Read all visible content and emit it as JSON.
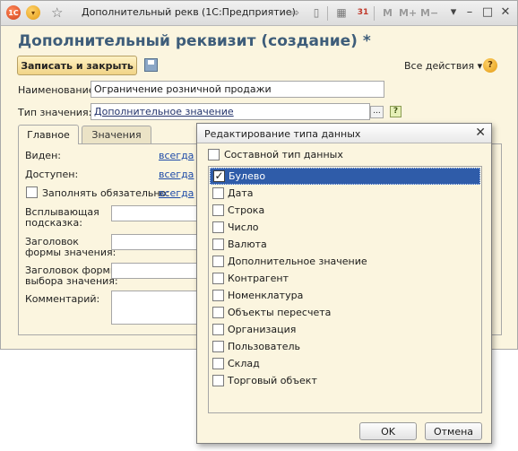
{
  "window": {
    "title": "Дополнительный рекв...",
    "app_name": "(1С:Предприятие)",
    "m_labels": [
      "M",
      "M+",
      "M−"
    ]
  },
  "form": {
    "title": "Дополнительный реквизит (создание) *",
    "save_close_label": "Записать и закрыть",
    "all_actions_label": "Все действия ▾",
    "name_label": "Наименование:",
    "name_value": "Ограничение розничной продажи",
    "value_type_label": "Тип значения:",
    "value_type_value": "Дополнительное значение",
    "value_type_button": "...",
    "tabs": [
      {
        "label": "Главное"
      },
      {
        "label": "Значения"
      }
    ],
    "main_tab": {
      "visible_label": "Виден:",
      "visible_link": "всегда",
      "available_label": "Доступен:",
      "available_link": "всегда",
      "required_label": "Заполнять обязательно:",
      "required_link": "всегда",
      "tooltip_label_1": "Всплывающая",
      "tooltip_label_2": "подсказка:",
      "form_header_label_1": "Заголовок",
      "form_header_label_2": "формы значения:",
      "select_header_label_1": "Заголовок формы",
      "select_header_label_2": "выбора значения:",
      "comment_label": "Комментарий:"
    }
  },
  "dialog": {
    "title": "Редактирование типа данных",
    "composite_label": "Составной тип данных",
    "types": [
      {
        "label": "Булево",
        "checked": true,
        "selected": true
      },
      {
        "label": "Дата",
        "checked": false
      },
      {
        "label": "Строка",
        "checked": false
      },
      {
        "label": "Число",
        "checked": false
      },
      {
        "label": "Валюта",
        "checked": false
      },
      {
        "label": "Дополнительное значение",
        "checked": false
      },
      {
        "label": "Контрагент",
        "checked": false
      },
      {
        "label": "Номенклатура",
        "checked": false
      },
      {
        "label": "Объекты пересчета",
        "checked": false
      },
      {
        "label": "Организация",
        "checked": false
      },
      {
        "label": "Пользователь",
        "checked": false
      },
      {
        "label": "Склад",
        "checked": false
      },
      {
        "label": "Торговый объект",
        "checked": false
      }
    ],
    "ok_label": "OK",
    "cancel_label": "Отмена"
  }
}
